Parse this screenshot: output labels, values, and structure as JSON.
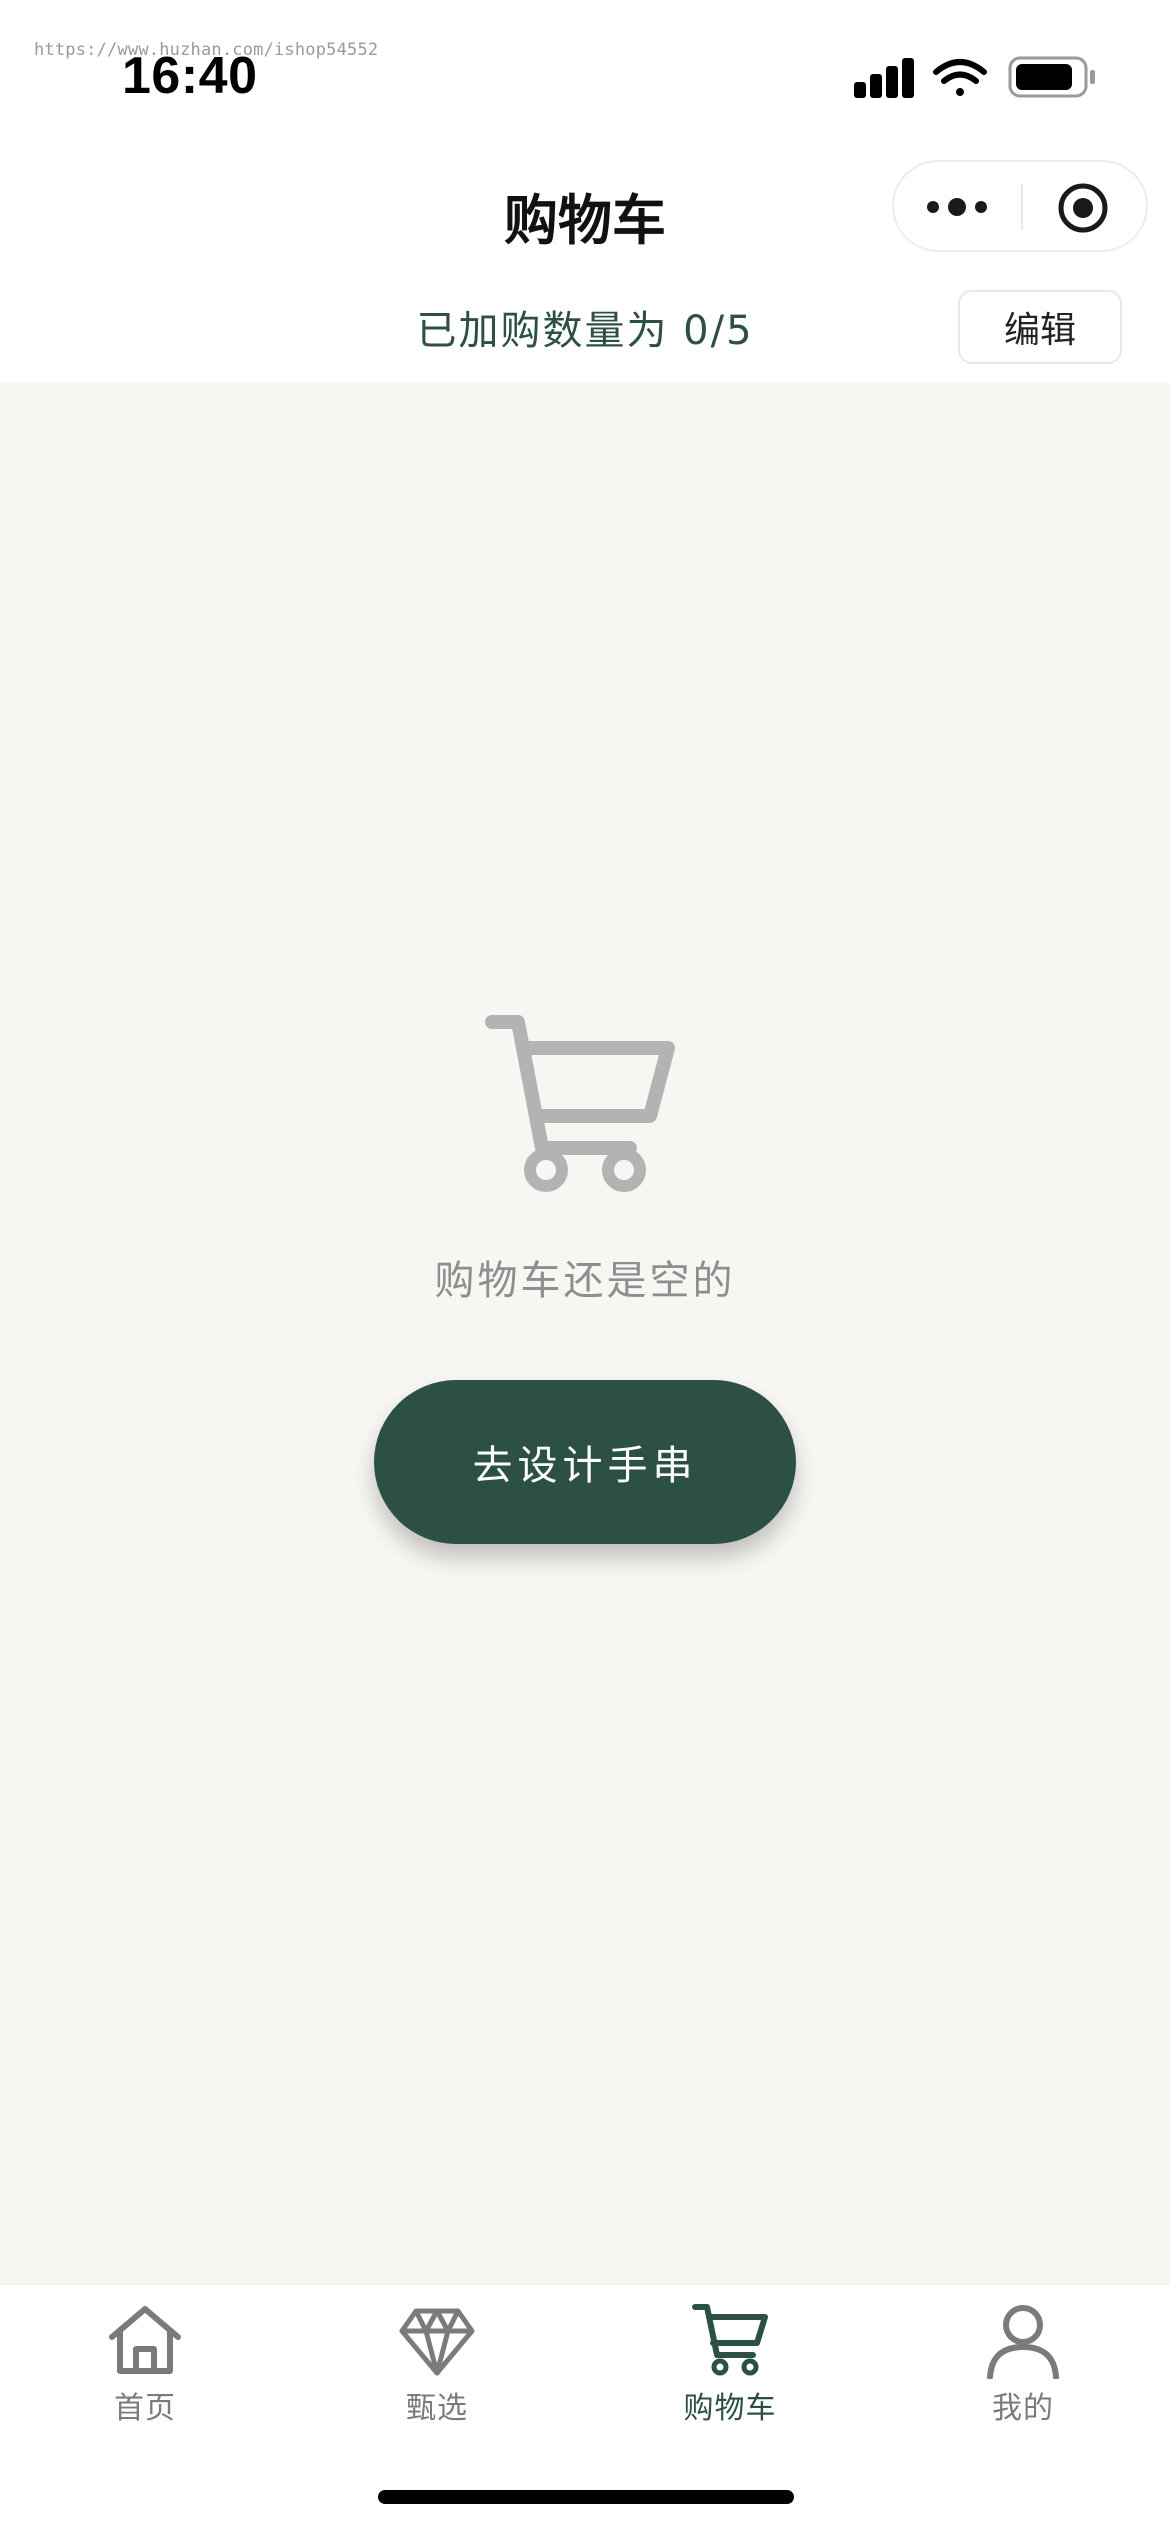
{
  "watermark": "https://www.huzhan.com/ishop54552",
  "status_bar": {
    "time": "16:40",
    "icons": [
      "signal-icon",
      "wifi-icon",
      "battery-icon"
    ]
  },
  "nav": {
    "title": "购物车",
    "capsule_icons": [
      "more-icon",
      "target-icon"
    ]
  },
  "cart": {
    "count_text": "已加购数量为 0/5",
    "edit_label": "编辑",
    "empty_icon": "cart-icon",
    "empty_text": "购物车还是空的",
    "design_button_label": "去设计手串"
  },
  "tabbar": {
    "items": [
      {
        "label": "首页",
        "icon": "home-icon",
        "active": false
      },
      {
        "label": "甄选",
        "icon": "diamond-icon",
        "active": false
      },
      {
        "label": "购物车",
        "icon": "cart-icon",
        "active": true
      },
      {
        "label": "我的",
        "icon": "user-icon",
        "active": false
      }
    ]
  },
  "colors": {
    "accent": "#2c5046",
    "page_background": "#f7f6f2",
    "muted_text": "#8e8e8e",
    "tab_inactive": "#7b7b7b"
  }
}
